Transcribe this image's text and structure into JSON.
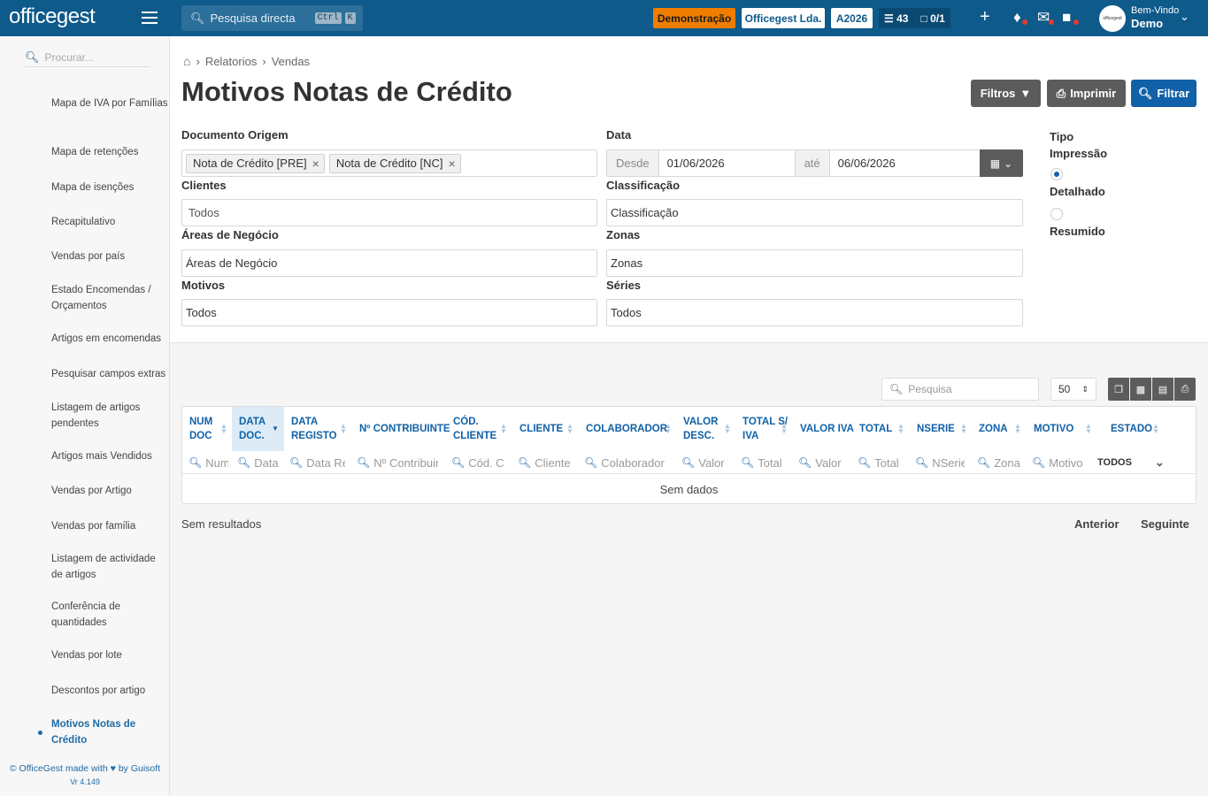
{
  "topbar": {
    "logo": "officegest",
    "search_label": "Pesquisa directa",
    "kbd_ctrl": "Ctrl",
    "kbd_k": "K",
    "demo_badge": "Demonstração",
    "company": "Officegest Lda.",
    "year": "A2026",
    "tasks_count": "43",
    "docs_count": "0/1",
    "welcome": "Bem-Vindo",
    "user": "Demo",
    "avatar_text": "officegest",
    "colors": {
      "bar": "#0e5a8a",
      "demo": "#ef7d00"
    }
  },
  "sidebar": {
    "search_placeholder": "Procurar...",
    "items": [
      {
        "label": "Mapa de IVA por Famílias"
      },
      {
        "label": "Mapa de retenções"
      },
      {
        "label": "Mapa de isenções"
      },
      {
        "label": "Recapitulativo"
      },
      {
        "label": "Vendas por país"
      },
      {
        "label": "Estado Encomendas / Orçamentos"
      },
      {
        "label": "Artigos em encomendas"
      },
      {
        "label": "Pesquisar campos extras"
      },
      {
        "label": "Listagem de artigos pendentes"
      },
      {
        "label": "Artigos mais Vendidos"
      },
      {
        "label": "Vendas por Artigo"
      },
      {
        "label": "Vendas por família"
      },
      {
        "label": "Listagem de actividade de artigos"
      },
      {
        "label": "Conferência de quantidades"
      },
      {
        "label": "Vendas por lote"
      },
      {
        "label": "Descontos por artigo"
      },
      {
        "label": "Motivos Notas de Crédito"
      }
    ],
    "footer_pre": "© OfficeGest made with",
    "footer_post": "by Guisoft",
    "version": "Vr 4.149"
  },
  "breadcrumb": {
    "level1": "Relatorios",
    "level2": "Vendas"
  },
  "page": {
    "title": "Motivos Notas de Crédito",
    "btn_filtros": "Filtros",
    "btn_imprimir": "Imprimir",
    "btn_filtrar": "Filtrar"
  },
  "filters": {
    "doc_origem_label": "Documento Origem",
    "doc_tags": [
      "Nota de Crédito [PRE]",
      "Nota de Crédito [NC]"
    ],
    "data_label": "Data",
    "desde": "Desde",
    "date_from": "01/06/2026",
    "ate": "até",
    "date_to": "06/06/2026",
    "clientes_label": "Clientes",
    "clientes_value": "Todos",
    "classificacao_label": "Classificação",
    "classificacao_value": "Classificação",
    "areas_label": "Áreas de Negócio",
    "areas_value": "Áreas de Negócio",
    "zonas_label": "Zonas",
    "zonas_value": "Zonas",
    "motivos_label": "Motivos",
    "motivos_value": "Todos",
    "series_label": "Séries",
    "series_value": "Todos",
    "tipo_label_1": "Tipo",
    "tipo_label_2": "Impressão",
    "opt_detalhado": "Detalhado",
    "opt_resumido": "Resumido",
    "selected": "Detalhado"
  },
  "table": {
    "search_placeholder": "Pesquisa",
    "page_size": "50",
    "columns": [
      {
        "label": "NUM DOC",
        "filter": "Num"
      },
      {
        "label": "DATA DOC.",
        "filter": "Data"
      },
      {
        "label": "DATA REGISTO",
        "filter": "Data Re"
      },
      {
        "label": "Nº CONTRIBUINTE",
        "filter": "Nº Contribuir"
      },
      {
        "label": "CÓD. CLIENTE",
        "filter": "Cód. Cl"
      },
      {
        "label": "CLIENTE",
        "filter": "Cliente"
      },
      {
        "label": "COLABORADOR",
        "filter": "Colaborador"
      },
      {
        "label": "VALOR DESC.",
        "filter": "Valor I"
      },
      {
        "label": "TOTAL S/ IVA",
        "filter": "Total S"
      },
      {
        "label": "VALOR IVA",
        "filter": "Valor I"
      },
      {
        "label": "TOTAL",
        "filter": "Total"
      },
      {
        "label": "NSERIE",
        "filter": "NSerie"
      },
      {
        "label": "ZONA",
        "filter": "Zona"
      },
      {
        "label": "MOTIVO",
        "filter": "Motivo"
      },
      {
        "label": "ESTADO",
        "filter": "TODOS"
      }
    ],
    "no_data": "Sem dados",
    "no_results": "Sem resultados",
    "prev": "Anterior",
    "next": "Seguinte"
  }
}
